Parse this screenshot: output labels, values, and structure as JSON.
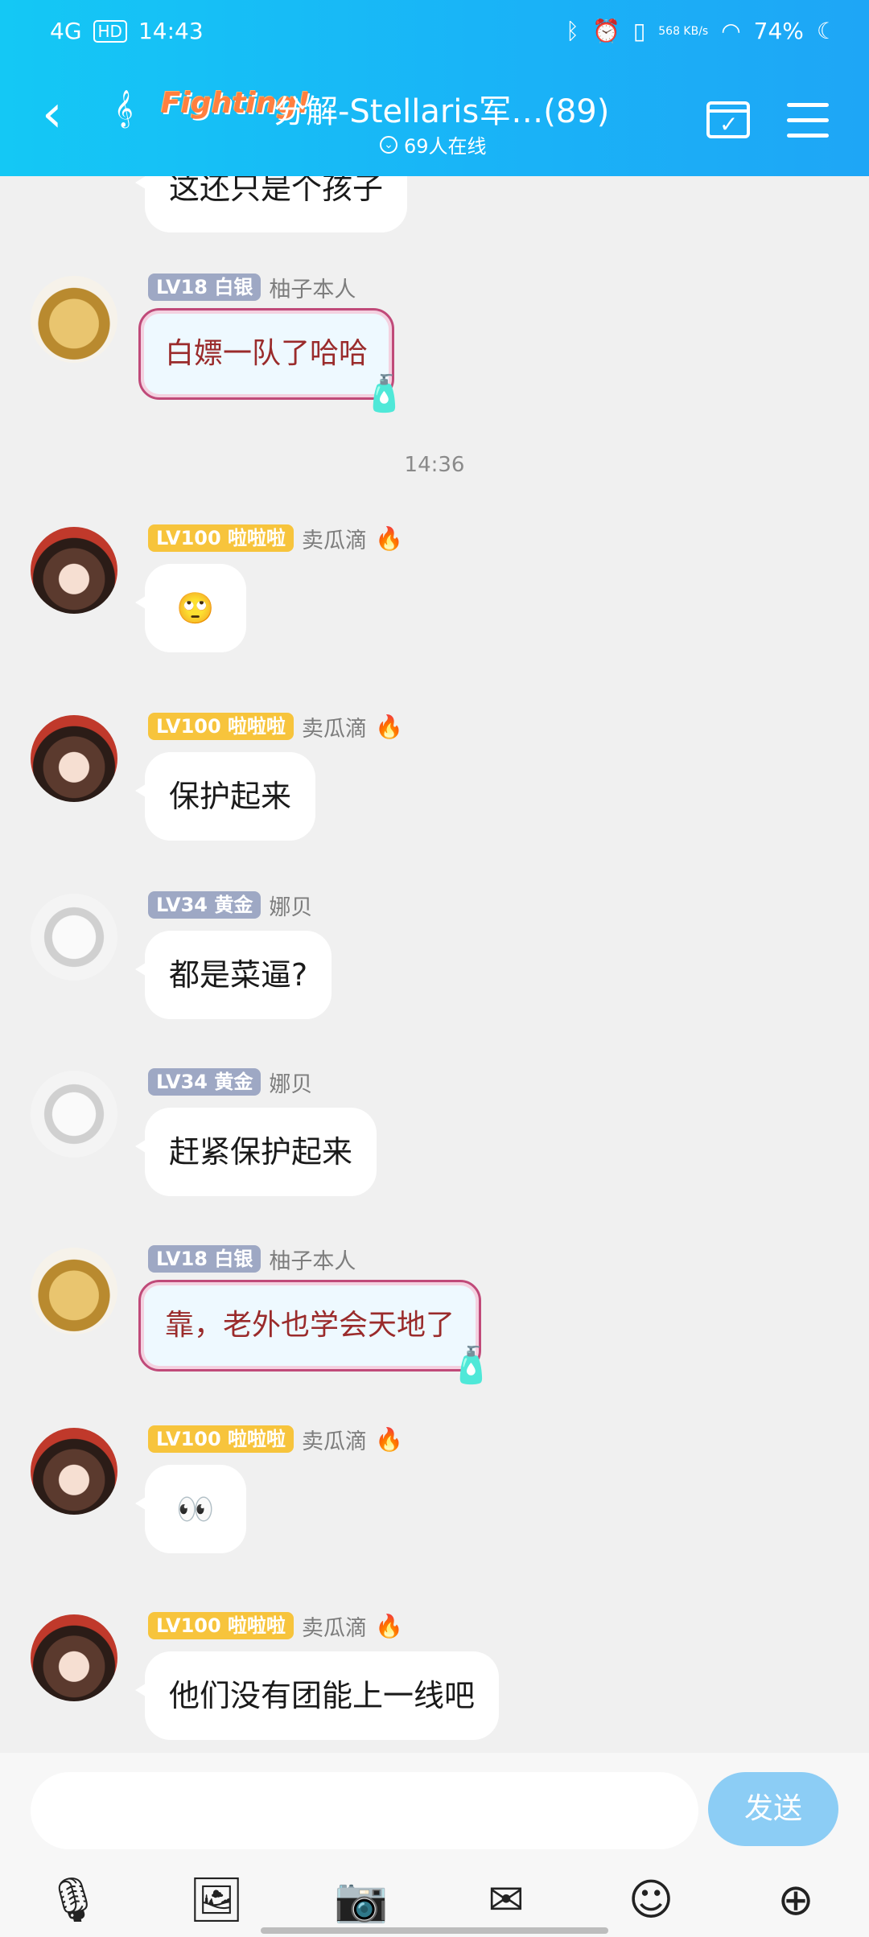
{
  "status_bar": {
    "network": "4G",
    "hd": "HD",
    "time": "14:43",
    "speed": "568 KB/s",
    "battery": "74%"
  },
  "header": {
    "decor": "Fighting!",
    "title": "分解-Stellaris军…(89)",
    "online": "69人在线"
  },
  "messages": [
    {
      "type": "text",
      "text": "这还只是个孩子"
    },
    {
      "badge": "LV18 白银",
      "name": "柚子本人",
      "text": "白嫖一队了哈哈",
      "fancy": true
    },
    {
      "time": "14:36"
    },
    {
      "badge": "LV100 啦啦啦",
      "name": "卖瓜滴",
      "text": "🙄"
    },
    {
      "badge": "LV100 啦啦啦",
      "name": "卖瓜滴",
      "text": "保护起来"
    },
    {
      "badge": "LV34 黄金",
      "name": "娜贝",
      "text": "都是菜逼?"
    },
    {
      "badge": "LV34 黄金",
      "name": "娜贝",
      "text": "赶紧保护起来"
    },
    {
      "badge": "LV18 白银",
      "name": "柚子本人",
      "text": "靠，老外也学会天地了",
      "fancy": true
    },
    {
      "badge": "LV100 啦啦啦",
      "name": "卖瓜滴",
      "text": "👀"
    },
    {
      "badge": "LV100 啦啦啦",
      "name": "卖瓜滴",
      "text": "他们没有团能上一线吧"
    }
  ],
  "input": {
    "placeholder": "",
    "send_label": "发送"
  },
  "toolbar": {
    "icons": [
      "microphone-icon",
      "image-icon",
      "camera-icon",
      "red-packet-icon",
      "emoji-icon",
      "plus-icon"
    ]
  }
}
